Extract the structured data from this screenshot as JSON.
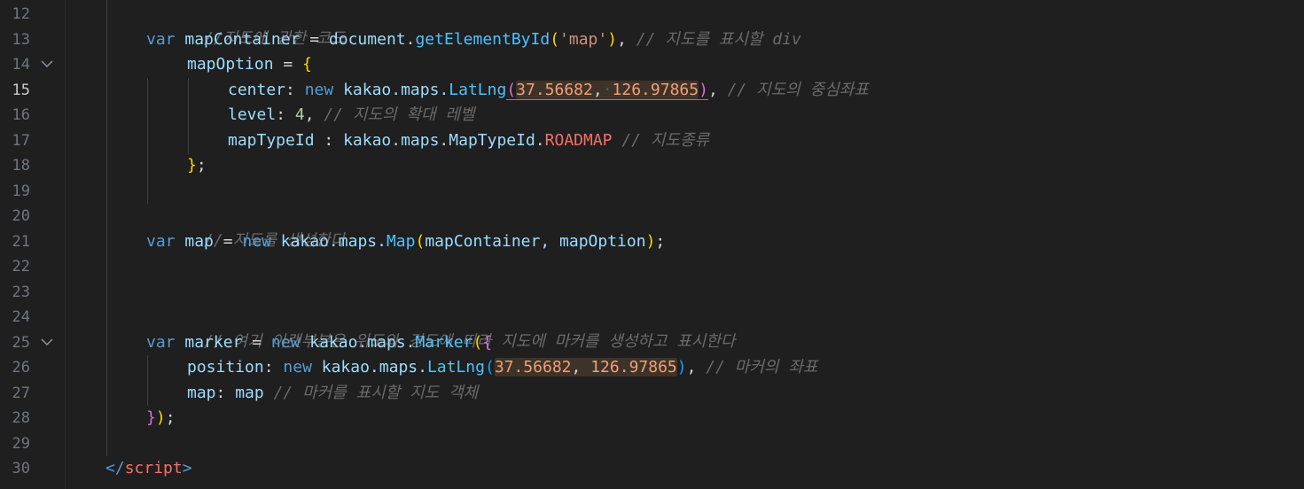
{
  "editor": {
    "line_numbers": [
      "12",
      "13",
      "14",
      "15",
      "16",
      "17",
      "18",
      "19",
      "20",
      "21",
      "22",
      "23",
      "24",
      "25",
      "26",
      "27",
      "28",
      "29",
      "30"
    ],
    "active_line": "15",
    "code": {
      "l12": {
        "comment": "//지도에 관한 코드"
      },
      "l13": {
        "kw": "var",
        "name": "mapContainer",
        "op": " = ",
        "obj": "document",
        "dot": ".",
        "fn": "getElementById",
        "open": "(",
        "str": "'map'",
        "close": ")",
        "sep": ", ",
        "comment": "// 지도를 표시할 div"
      },
      "l14": {
        "prop": "mapOption",
        "op": " = ",
        "open": "{"
      },
      "l15": {
        "prop": "center",
        "colon": ": ",
        "kw": "new",
        "ns": " kakao.maps.",
        "fn": "LatLng",
        "open": "(",
        "n1": "37.56682",
        "comma": ",",
        "space": "·",
        "n2": "126.97865",
        "close": ")",
        "sep": ", ",
        "comment": "// 지도의 중심좌표"
      },
      "l16": {
        "prop": "level",
        "colon": ": ",
        "num": "4",
        "sep": ", ",
        "comment": "// 지도의 확대 레벨"
      },
      "l17": {
        "prop": "mapTypeId",
        "colon": " : ",
        "ns": "kakao.maps.MapTypeId.",
        "enum": "ROADMAP",
        "sep": " ",
        "comment": "// 지도종류"
      },
      "l18": {
        "close": "}",
        "semi": ";"
      },
      "l20": {
        "comment": "// 지도를 생성한다"
      },
      "l21": {
        "kw": "var",
        "name": " map",
        "op": " = ",
        "kw2": "new",
        "ns": " kakao.maps.",
        "fn": "Map",
        "open": "(",
        "args": "mapContainer, mapOption",
        "close": ")",
        "semi": ";"
      },
      "l24": {
        "comment": "// 여기 아랫부분은 위도와 경도에 따라 지도에 마커를 생성하고 표시한다"
      },
      "l25": {
        "kw": "var",
        "name": " marker",
        "op": " = ",
        "kw2": "new",
        "ns": " kakao.maps.",
        "fn": "Marker",
        "open1": "(",
        "open2": "{"
      },
      "l26": {
        "prop": "position",
        "colon": ": ",
        "kw": "new",
        "ns": " kakao.maps.",
        "fn": "LatLng",
        "open": "(",
        "n1": "37.56682",
        "comma": ", ",
        "n2": "126.97865",
        "close": ")",
        "sep": ", ",
        "comment": "// 마커의 좌표"
      },
      "l27": {
        "prop": "map",
        "colon": ": ",
        "val": "map",
        "sep": " ",
        "comment": "// 마커를 표시할 지도 객체"
      },
      "l28": {
        "close2": "}",
        "close1": ")",
        "semi": ";"
      },
      "l30": {
        "tag_open": "</",
        "tag_name": "script",
        "tag_close": ">"
      }
    }
  },
  "colors": {
    "background": "#1f1f1f",
    "keyword": "#569cd6",
    "variable": "#9cdcfe",
    "function": "#4fc1ff",
    "string": "#ce9178",
    "comment": "#6a6a6a",
    "bracket_gold": "#ffd700",
    "bracket_magenta": "#da70d6",
    "enum": "#f47067"
  }
}
